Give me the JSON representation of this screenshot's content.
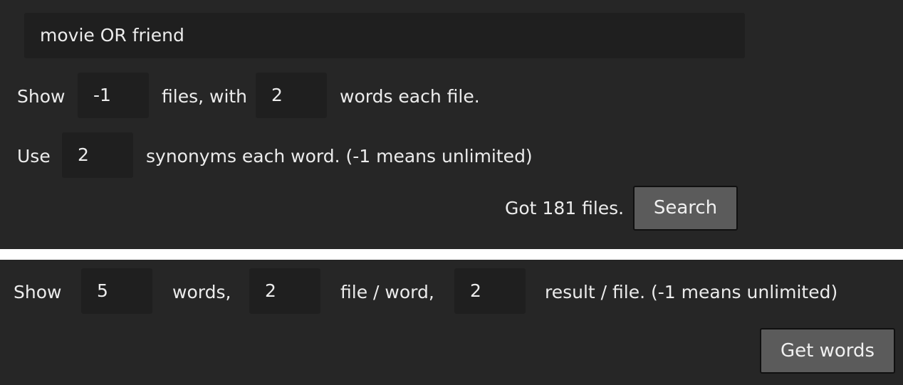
{
  "search": {
    "query_value": "movie OR friend",
    "row1": {
      "label_show": "Show",
      "files_value": "-1",
      "label_files_with": "files, with",
      "words_value": "2",
      "label_words_each_file": "words each file."
    },
    "row2": {
      "label_use": "Use",
      "synonyms_value": "2",
      "label_synonyms_each_word": "synonyms each word. (-1 means unlimited)"
    },
    "status_text": "Got 181 files.",
    "search_button_label": "Search"
  },
  "words": {
    "label_show": "Show",
    "words_value": "5",
    "label_words": "words,",
    "file_per_word_value": "2",
    "label_file_per_word": "file / word,",
    "result_per_file_value": "2",
    "label_result_per_file": "result / file. (-1 means unlimited)",
    "get_words_button_label": "Get words"
  },
  "colors": {
    "panel_bg": "#262626",
    "field_bg": "#1f1f1f",
    "button_bg": "#5b5b5b",
    "divider": "#ffffff"
  }
}
